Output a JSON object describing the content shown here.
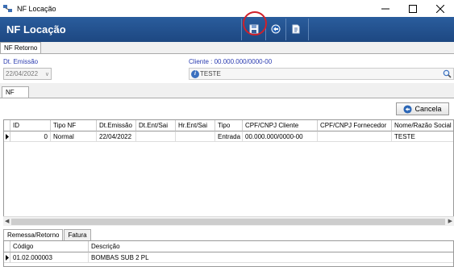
{
  "window": {
    "title": "NF Locação"
  },
  "header": {
    "title": "NF Locação"
  },
  "form_tab": {
    "label": "NF Retorno"
  },
  "form": {
    "date_label": "Dt. Emissão",
    "date_value": "22/04/2022",
    "client_label": "Cliente : 00.000.000/0000-00",
    "client_value": "TESTE"
  },
  "inner_tab": {
    "label": "NF"
  },
  "cancel_button": {
    "label": "Cancela"
  },
  "grid": {
    "columns": [
      "ID",
      "Tipo NF",
      "Dt.Emissão",
      "Dt.Ent/Sai",
      "Hr.Ent/Sai",
      "Tipo",
      "CPF/CNPJ Cliente",
      "CPF/CNPJ Fornecedor",
      "Nome/Razão Social"
    ],
    "rows": [
      [
        "0",
        "Normal",
        "22/04/2022",
        "",
        "",
        "Entrada",
        "00.000.000/0000-00",
        "",
        "TESTE"
      ]
    ]
  },
  "bottom_tabs": [
    "Remessa/Retorno",
    "Fatura"
  ],
  "items_grid": {
    "columns": [
      "Código",
      "Descrição"
    ],
    "rows": [
      [
        "01.02.000003",
        "BOMBAS SUB 2 PL"
      ]
    ]
  },
  "colors": {
    "header": "#1d4781",
    "highlight_circle": "#d0202a"
  }
}
